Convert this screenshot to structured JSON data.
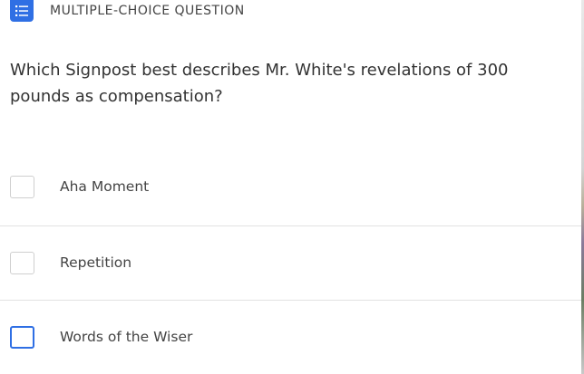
{
  "header": {
    "type_icon": "list-icon",
    "type_label": "MULTIPLE-CHOICE QUESTION"
  },
  "question": {
    "text": "Which Signpost best describes Mr. White's revelations of 300 pounds as compensation?"
  },
  "options": [
    {
      "label": "Aha Moment",
      "checked": false,
      "focused": false
    },
    {
      "label": "Repetition",
      "checked": false,
      "focused": false
    },
    {
      "label": "Words of the Wiser",
      "checked": false,
      "focused": true
    }
  ],
  "colors": {
    "accent": "#2f6fe4",
    "text": "#333333",
    "checkbox_border": "#cfcfcf",
    "divider": "#e2e2e2"
  }
}
